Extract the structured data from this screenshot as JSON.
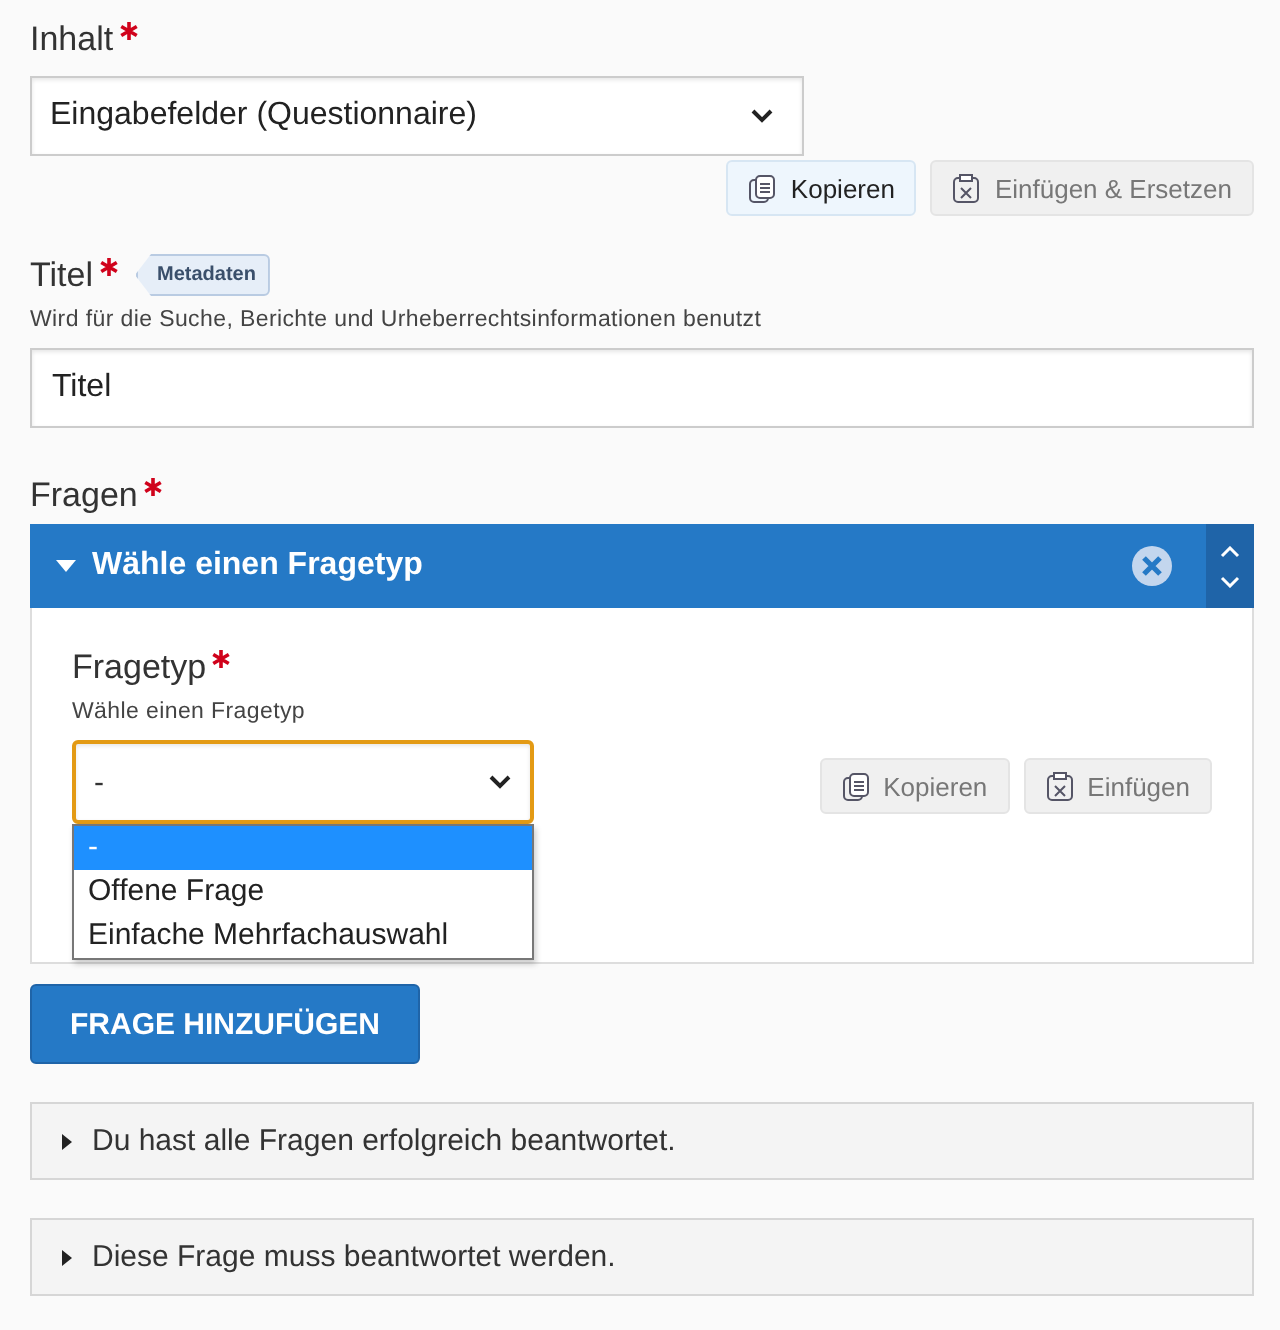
{
  "content_field": {
    "label": "Inhalt",
    "required": true,
    "value": "Eingabefelder (Questionnaire)",
    "buttons": [
      {
        "label": "Kopieren",
        "kind": "copy",
        "disabled": false
      },
      {
        "label": "Einfügen & Ersetzen",
        "kind": "paste",
        "disabled": true
      }
    ]
  },
  "title_field": {
    "label": "Titel",
    "required": true,
    "badge": "Metadaten",
    "help": "Wird für die Suche, Berichte und Urheberrechtsinformationen benutzt",
    "value": "Titel"
  },
  "questions": {
    "label": "Fragen",
    "required": true,
    "items": [
      {
        "title": "Wähle einen Fragetyp",
        "expanded": true,
        "type_field": {
          "label": "Fragetyp",
          "required": true,
          "help": "Wähle einen Fragetyp",
          "value": "-",
          "open": true,
          "options": [
            {
              "label": "-",
              "selected": true
            },
            {
              "label": "Offene Frage",
              "selected": false
            },
            {
              "label": "Einfache Mehrfachauswahl",
              "selected": false
            }
          ]
        },
        "buttons": [
          {
            "label": "Kopieren",
            "kind": "copy",
            "disabled": true
          },
          {
            "label": "Einfügen",
            "kind": "paste",
            "disabled": true
          }
        ]
      }
    ],
    "add_button": "FRAGE HINZUFÜGEN"
  },
  "feedback": [
    {
      "label": "Du hast alle Fragen erfolgreich beantwortet.",
      "expanded": false
    },
    {
      "label": "Diese Frage muss beantwortet werden.",
      "expanded": false
    }
  ]
}
